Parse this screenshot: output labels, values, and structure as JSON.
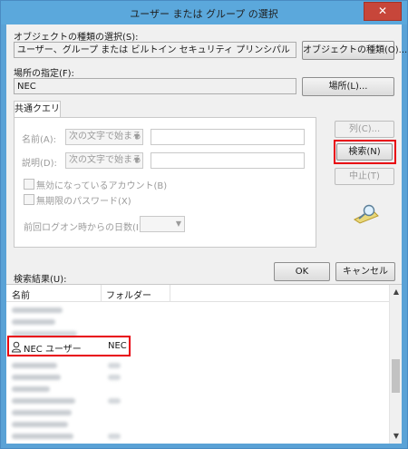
{
  "window": {
    "title": "ユーザー または グループ の選択",
    "close_glyph": "✕"
  },
  "object_type": {
    "label": "オブジェクトの種類の選択(S):",
    "value": "ユーザー、グループ または ビルトイン セキュリティ プリンシパル",
    "button": "オブジェクトの種類(O)..."
  },
  "location": {
    "label": "場所の指定(F):",
    "value": "NEC",
    "button": "場所(L)..."
  },
  "common_query": {
    "tab": "共通クエリ",
    "name_label": "名前(A):",
    "name_mode": "次の文字で始まる",
    "desc_label": "説明(D):",
    "desc_mode": "次の文字で始まる",
    "disabled_accounts": "無効になっているアカウント(B)",
    "nonexpiring_pw": "無期限のパスワード(X)",
    "days_since_logon": "前回ログオン時からの日数(I):"
  },
  "side_buttons": {
    "columns": "列(C)...",
    "search": "検索(N)",
    "stop": "中止(T)"
  },
  "dialog_buttons": {
    "ok": "OK",
    "cancel": "キャンセル"
  },
  "results": {
    "label": "検索結果(U):",
    "columns": [
      "名前",
      "フォルダー"
    ],
    "highlighted_row": {
      "name": "NEC ユーザー",
      "folder": "NEC"
    }
  },
  "colors": {
    "accent": "#e8000e",
    "titlebar": "#5ba8dc",
    "close": "#c7463a"
  }
}
